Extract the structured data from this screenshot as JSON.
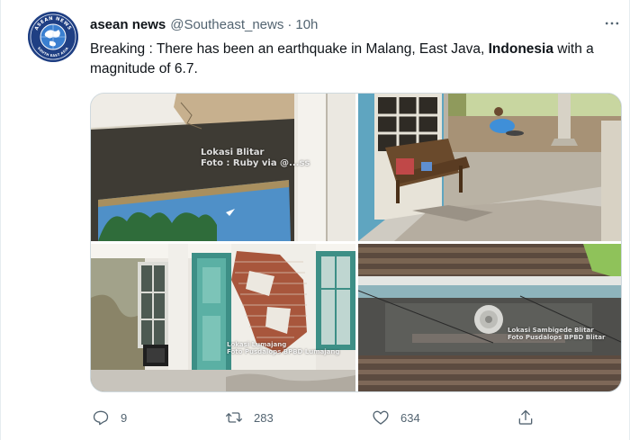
{
  "account": {
    "display_name": "asean news",
    "handle": "@Southeast_news",
    "separator": "·",
    "time": "10h",
    "avatar": {
      "top_text": "ASEAN NEWS",
      "bottom_text": "SOUTH EAST ASIA"
    }
  },
  "tweet": {
    "text_part1": "Breaking : There has been an earthquake in Malang, East Java, ",
    "text_bold": "Indonesia",
    "text_part2": " with a magnitude of 6.7."
  },
  "media": {
    "photo1": {
      "watermark_line1": "Lokasi Blitar",
      "watermark_line2": "Foto : Ruby via @...ss"
    },
    "photo3": {
      "watermark_line1": "Lokasi Lumajang",
      "watermark_line2": "Foto Pusdalops BPBD Lumajang"
    },
    "photo4": {
      "watermark_line1": "Lokasi Sambigede Blitar",
      "watermark_line2": "Foto Pusdalops BPBD Blitar"
    }
  },
  "actions": {
    "reply_count": "9",
    "retweet_count": "283",
    "like_count": "634"
  },
  "icons": [
    "globe-logo-icon",
    "more-dots-icon",
    "reply-icon",
    "retweet-icon",
    "like-icon",
    "share-icon"
  ],
  "colors": {
    "text": "#0f1419",
    "secondary": "#536471",
    "border": "#cfd9de",
    "avatar_bg": "#1f3f83"
  }
}
